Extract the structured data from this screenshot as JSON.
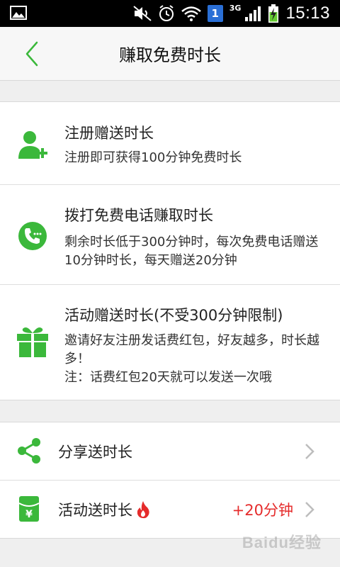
{
  "status_bar": {
    "time": "15:13",
    "notification_badge": "1",
    "network_type": "3G",
    "icons": [
      "image-icon",
      "mute-icon",
      "alarm-icon",
      "wifi-icon",
      "signal-icon",
      "battery-charging-icon"
    ]
  },
  "header": {
    "title": "赚取免费时长",
    "back_icon": "chevron-left-icon"
  },
  "earn_items": [
    {
      "icon": "add-user-icon",
      "title": "注册赠送时长",
      "desc": "注册即可获得100分钟免费时长"
    },
    {
      "icon": "phone-icon",
      "title": "拨打免费电话赚取时长",
      "desc": "剩余时长低于300分钟时，每次免费电话赠送10分钟时长，每天赠送20分钟"
    },
    {
      "icon": "gift-icon",
      "title": "活动赠送时长(不受300分钟限制)",
      "desc_line1": "邀请好友注册发话费红包，好友越多，时长越多！",
      "desc_line2": "注：话费红包20天就可以发送一次哦"
    }
  ],
  "list_items": [
    {
      "icon": "share-icon",
      "label": "分享送时长"
    },
    {
      "icon": "red-envelope-icon",
      "label": "活动送时长",
      "badge_icon": "flame-icon",
      "value": "+20分钟"
    }
  ],
  "watermark": "Baidu经验",
  "colors": {
    "accent_green": "#3bb83b",
    "value_red": "#e52b2b"
  }
}
